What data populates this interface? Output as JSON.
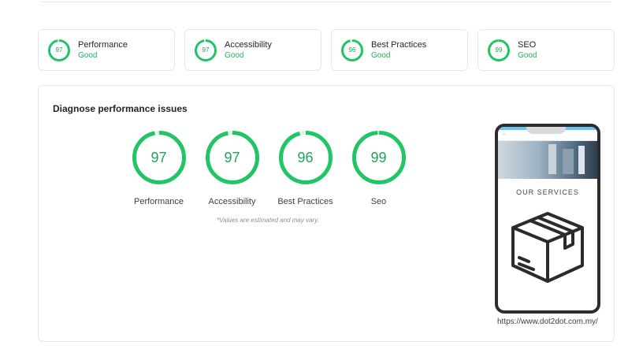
{
  "summary_cards": [
    {
      "score": "97",
      "title": "Performance",
      "status": "Good",
      "value": 97
    },
    {
      "score": "97",
      "title": "Accessibility",
      "status": "Good",
      "value": 97
    },
    {
      "score": "96",
      "title": "Best Practices",
      "status": "Good",
      "value": 96
    },
    {
      "score": "99",
      "title": "SEO",
      "status": "Good",
      "value": 99
    }
  ],
  "panel": {
    "title": "Diagnose performance issues",
    "gauges": [
      {
        "score": "97",
        "label": "Performance",
        "value": 97
      },
      {
        "score": "97",
        "label": "Accessibility",
        "value": 97
      },
      {
        "score": "96",
        "label": "Best Practices",
        "value": 96
      },
      {
        "score": "99",
        "label": "Seo",
        "value": 99
      }
    ],
    "note": "*Values are estimated and may vary.",
    "preview": {
      "heading": "OUR SERVICES",
      "url": "https://www.dot2dot.com.my/"
    }
  },
  "colors": {
    "good": "#1fa35b",
    "ring_track": "#dff3e6",
    "border": "#e3e6ea"
  }
}
